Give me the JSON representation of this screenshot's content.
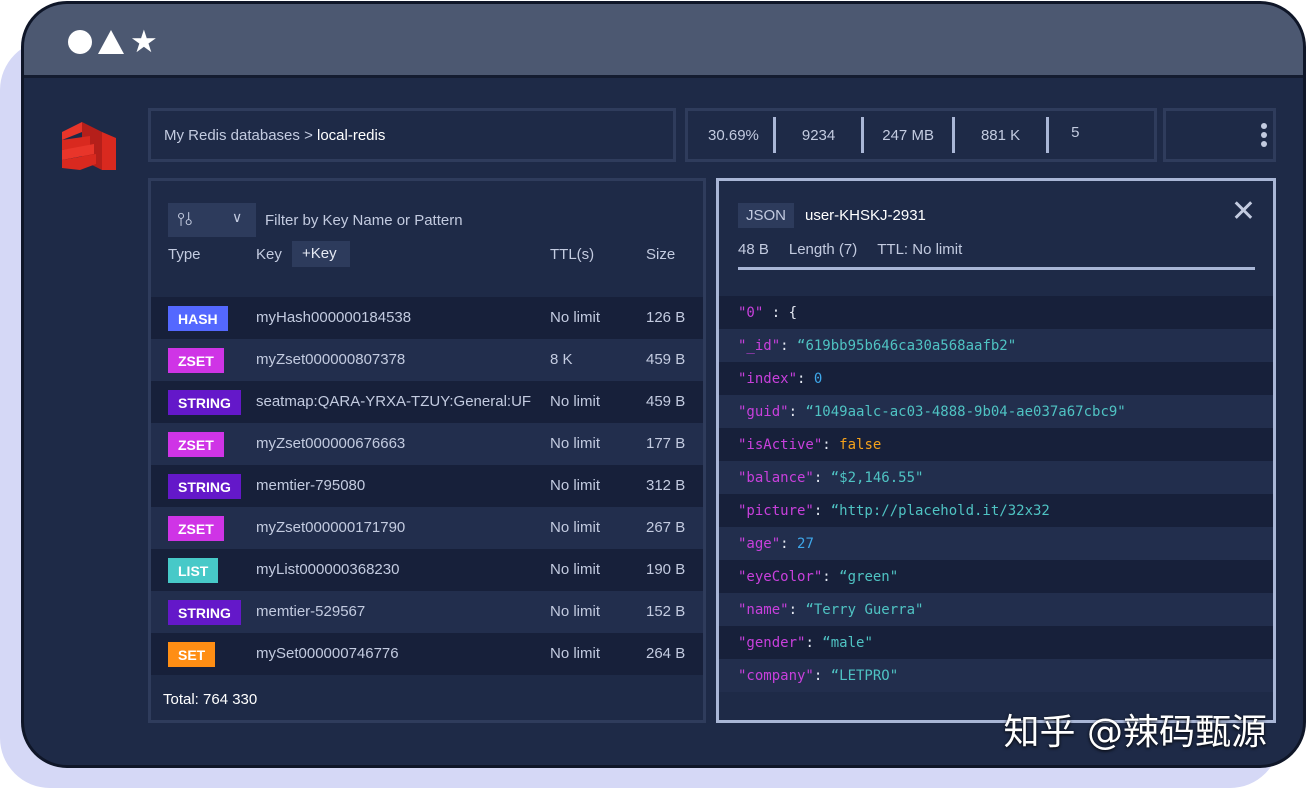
{
  "window": {
    "controls": [
      "circle",
      "triangle",
      "star"
    ]
  },
  "breadcrumb": {
    "parent": "My Redis databases >",
    "current": "local-redis"
  },
  "stats": [
    "30.69%",
    "9234",
    "247 MB",
    "881 K",
    "5"
  ],
  "browser": {
    "filter_placeholder": "Filter by Key Name or Pattern",
    "headers": {
      "type": "Type",
      "key": "Key",
      "add_key": "+Key",
      "ttl": "TTL(s)",
      "size": "Size"
    },
    "rows": [
      {
        "type": "HASH",
        "key": "myHash000000184538",
        "ttl": "No limit",
        "size": "126 B"
      },
      {
        "type": "ZSET",
        "key": "myZset000000807378",
        "ttl": "8 K",
        "size": "459 B"
      },
      {
        "type": "STRING",
        "key": "seatmap:QARA-YRXA-TZUY:General:UF",
        "ttl": "No limit",
        "size": "459 B"
      },
      {
        "type": "ZSET",
        "key": "myZset000000676663",
        "ttl": "No limit",
        "size": "177 B"
      },
      {
        "type": "STRING",
        "key": "memtier-795080",
        "ttl": "No limit",
        "size": "312 B"
      },
      {
        "type": "ZSET",
        "key": "myZset000000171790",
        "ttl": "No limit",
        "size": "267 B"
      },
      {
        "type": "LIST",
        "key": "myList000000368230",
        "ttl": "No limit",
        "size": "190 B"
      },
      {
        "type": "STRING",
        "key": "memtier-529567",
        "ttl": "No limit",
        "size": "152 B"
      },
      {
        "type": "SET",
        "key": "mySet000000746776",
        "ttl": "No limit",
        "size": "264 B"
      }
    ],
    "total": "Total: 764 330"
  },
  "type_colors": {
    "HASH": "#5468ff",
    "ZSET": "#cf34e6",
    "STRING": "#6418c9",
    "LIST": "#47c9c8",
    "SET": "#ff8e14"
  },
  "detail": {
    "type": "JSON",
    "key": "user-KHSKJ-2931",
    "size": "48 B",
    "length": "Length (7)",
    "ttl": "TTL: No limit",
    "lines": [
      {
        "key": "\"0\"",
        "sep": " : ",
        "value": "{",
        "kind": "plain"
      },
      {
        "key": "\"_id\"",
        "sep": ": ",
        "value": "“619bb95b646ca30a568aafb2\"",
        "kind": "str"
      },
      {
        "key": "\"index\"",
        "sep": ": ",
        "value": "0",
        "kind": "num"
      },
      {
        "key": "\"guid\"",
        "sep": ": ",
        "value": "“1049aalc-ac03-4888-9b04-ae037a67cbc9\"",
        "kind": "str"
      },
      {
        "key": "\"isActive\"",
        "sep": ": ",
        "value": "false",
        "kind": "bool"
      },
      {
        "key": "\"balance\"",
        "sep": ": ",
        "value": "“$2,146.55\"",
        "kind": "str"
      },
      {
        "key": "\"picture\"",
        "sep": ": ",
        "value": "“http://placehold.it/32x32",
        "kind": "str"
      },
      {
        "key": "\"age\"",
        "sep": ": ",
        "value": "27",
        "kind": "num"
      },
      {
        "key": "\"eyeColor\"",
        "sep": ": ",
        "value": "“green\"",
        "kind": "str"
      },
      {
        "key": "\"name\"",
        "sep": ": ",
        "value": "“Terry Guerra\"",
        "kind": "str"
      },
      {
        "key": "\"gender\"",
        "sep": ": ",
        "value": "“male\"",
        "kind": "str"
      },
      {
        "key": "\"company\"",
        "sep": ": ",
        "value": "“LETPRO\"",
        "kind": "str"
      }
    ]
  },
  "watermark": "知乎 @辣码甄源"
}
